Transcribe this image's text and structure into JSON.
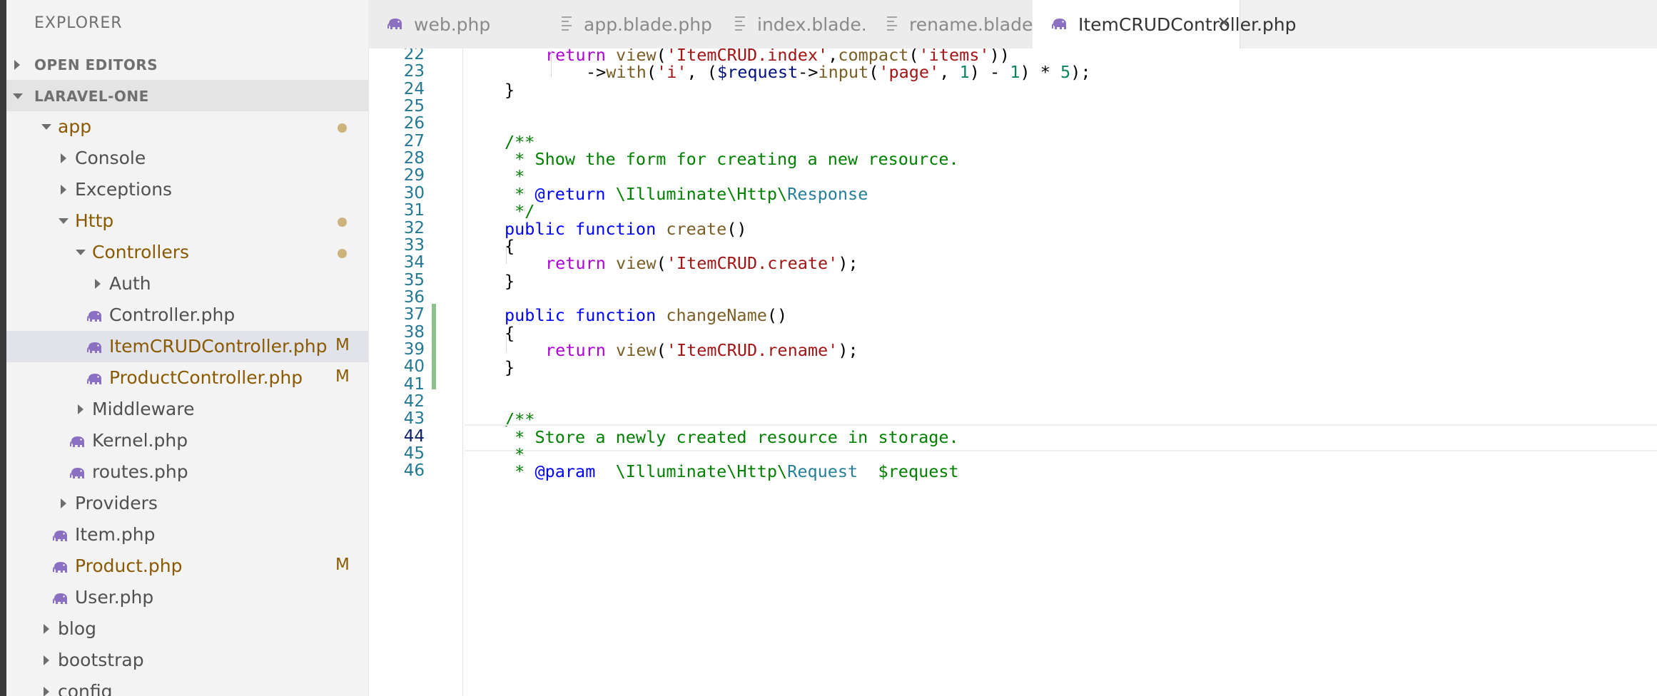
{
  "sidebar": {
    "title": "EXPLORER",
    "sections": {
      "open_editors": "OPEN EDITORS",
      "project": "LARAVEL-ONE"
    },
    "tree": [
      {
        "label": "app",
        "type": "folder-open",
        "modified_dot": true
      },
      {
        "label": "Console",
        "type": "folder"
      },
      {
        "label": "Exceptions",
        "type": "folder"
      },
      {
        "label": "Http",
        "type": "folder-open",
        "modified_dot": true
      },
      {
        "label": "Controllers",
        "type": "folder-open",
        "modified_dot": true
      },
      {
        "label": "Auth",
        "type": "folder"
      },
      {
        "label": "Controller.php",
        "type": "php"
      },
      {
        "label": "ItemCRUDController.php",
        "type": "php",
        "badge": "M",
        "selected": true
      },
      {
        "label": "ProductController.php",
        "type": "php",
        "badge": "M"
      },
      {
        "label": "Middleware",
        "type": "folder"
      },
      {
        "label": "Kernel.php",
        "type": "php"
      },
      {
        "label": "routes.php",
        "type": "php"
      },
      {
        "label": "Providers",
        "type": "folder"
      },
      {
        "label": "Item.php",
        "type": "php"
      },
      {
        "label": "Product.php",
        "type": "php",
        "badge": "M"
      },
      {
        "label": "User.php",
        "type": "php"
      },
      {
        "label": "blog",
        "type": "folder"
      },
      {
        "label": "bootstrap",
        "type": "folder"
      },
      {
        "label": "config",
        "type": "folder"
      }
    ]
  },
  "tabs": [
    {
      "label": "web.php",
      "icon": "php-elephant-icon"
    },
    {
      "label": "app.blade.php",
      "icon": "file-lines-icon"
    },
    {
      "label": "index.blade.php",
      "icon": "file-lines-icon"
    },
    {
      "label": "rename.blade.php",
      "icon": "file-lines-icon"
    },
    {
      "label": "ItemCRUDController.php",
      "icon": "php-elephant-icon",
      "active": true,
      "close": "✕"
    }
  ],
  "editor": {
    "current_line": "44",
    "lines": [
      {
        "n": "22",
        "code": "return view('ItemCRUD.index',compact('items'))"
      },
      {
        "n": "23",
        "code": "->with('i', ($request->input('page', 1) - 1) * 5);"
      },
      {
        "n": "24",
        "code": "}"
      },
      {
        "n": "25",
        "code": ""
      },
      {
        "n": "26",
        "code": ""
      },
      {
        "n": "27",
        "code": "/**"
      },
      {
        "n": "28",
        "code": " * Show the form for creating a new resource."
      },
      {
        "n": "29",
        "code": " *"
      },
      {
        "n": "30",
        "code": " * @return \\Illuminate\\Http\\Response"
      },
      {
        "n": "31",
        "code": " */"
      },
      {
        "n": "32",
        "code": "public function create()"
      },
      {
        "n": "33",
        "code": "{"
      },
      {
        "n": "34",
        "code": "return view('ItemCRUD.create');"
      },
      {
        "n": "35",
        "code": "}"
      },
      {
        "n": "36",
        "code": ""
      },
      {
        "n": "37",
        "code": "public function changeName()"
      },
      {
        "n": "38",
        "code": "{"
      },
      {
        "n": "39",
        "code": "return view('ItemCRUD.rename');"
      },
      {
        "n": "40",
        "code": "}"
      },
      {
        "n": "41",
        "code": ""
      },
      {
        "n": "42",
        "code": ""
      },
      {
        "n": "43",
        "code": "/**"
      },
      {
        "n": "44",
        "code": " * Store a newly created resource in storage."
      },
      {
        "n": "45",
        "code": " *"
      },
      {
        "n": "46",
        "code": " * @param  \\Illuminate\\Http\\Request  $request"
      }
    ]
  },
  "colors": {
    "keyword": "#0000ff",
    "control": "#af00db",
    "function": "#795e26",
    "string": "#a31515",
    "variable": "#001080",
    "number": "#098658",
    "comment": "#008000",
    "type": "#267f99",
    "line_number": "#237893",
    "modified": "#8a5a00",
    "added_gutter": "#8bc28a"
  }
}
